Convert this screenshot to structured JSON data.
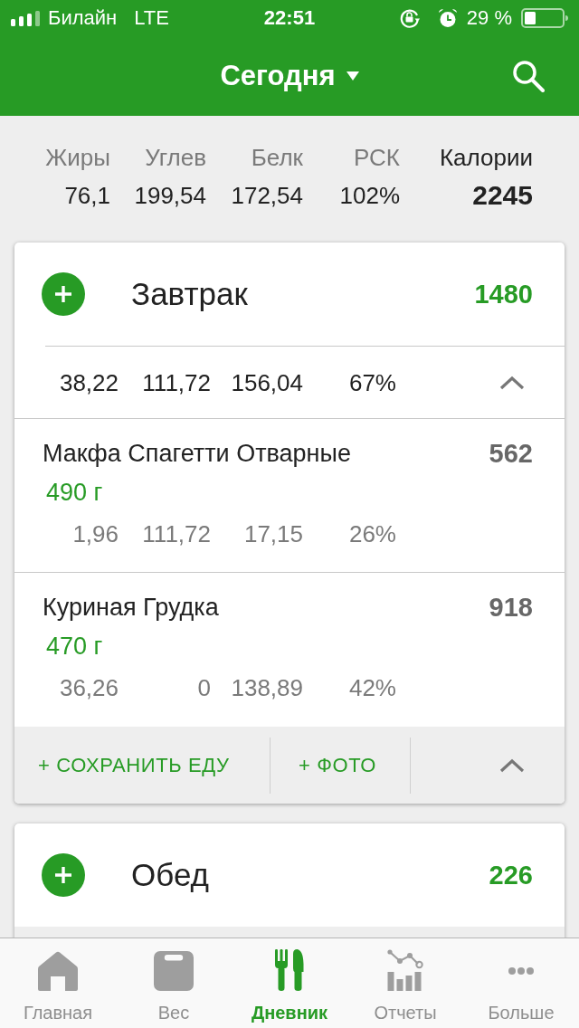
{
  "status_bar": {
    "carrier": "Билайн",
    "network": "LTE",
    "time": "22:51",
    "battery": "29 %"
  },
  "header": {
    "title": "Сегодня"
  },
  "summary": [
    {
      "label": "Жиры",
      "value": "76,1",
      "kind": "macro"
    },
    {
      "label": "Углев",
      "value": "199,54",
      "kind": "macro"
    },
    {
      "label": "Белк",
      "value": "172,54",
      "kind": "macro"
    },
    {
      "label": "РСК",
      "value": "102%",
      "kind": "macro"
    },
    {
      "label": "Калории",
      "value": "2245",
      "kind": "total"
    }
  ],
  "meals": [
    {
      "name": "Завтрак",
      "calories": "1480",
      "expanded": true,
      "totals": [
        "38,22",
        "111,72",
        "156,04",
        "67%"
      ],
      "foods": [
        {
          "name": "Макфа Спагетти Отварные",
          "amount": "490 г",
          "calories": "562",
          "macros": [
            "1,96",
            "111,72",
            "17,15",
            "26%"
          ]
        },
        {
          "name": "Куриная Грудка",
          "amount": "470 г",
          "calories": "918",
          "macros": [
            "36,26",
            "0",
            "138,89",
            "42%"
          ]
        }
      ],
      "actions": [
        "+ СОХРАНИТЬ ЕДУ",
        "+ ФОТО"
      ]
    },
    {
      "name": "Обед",
      "calories": "226",
      "expanded": false
    }
  ],
  "tabs": [
    {
      "label": "Главная",
      "selected": false
    },
    {
      "label": "Вес",
      "selected": false
    },
    {
      "label": "Дневник",
      "selected": true
    },
    {
      "label": "Отчеты",
      "selected": false
    },
    {
      "label": "Больше",
      "selected": false
    }
  ]
}
